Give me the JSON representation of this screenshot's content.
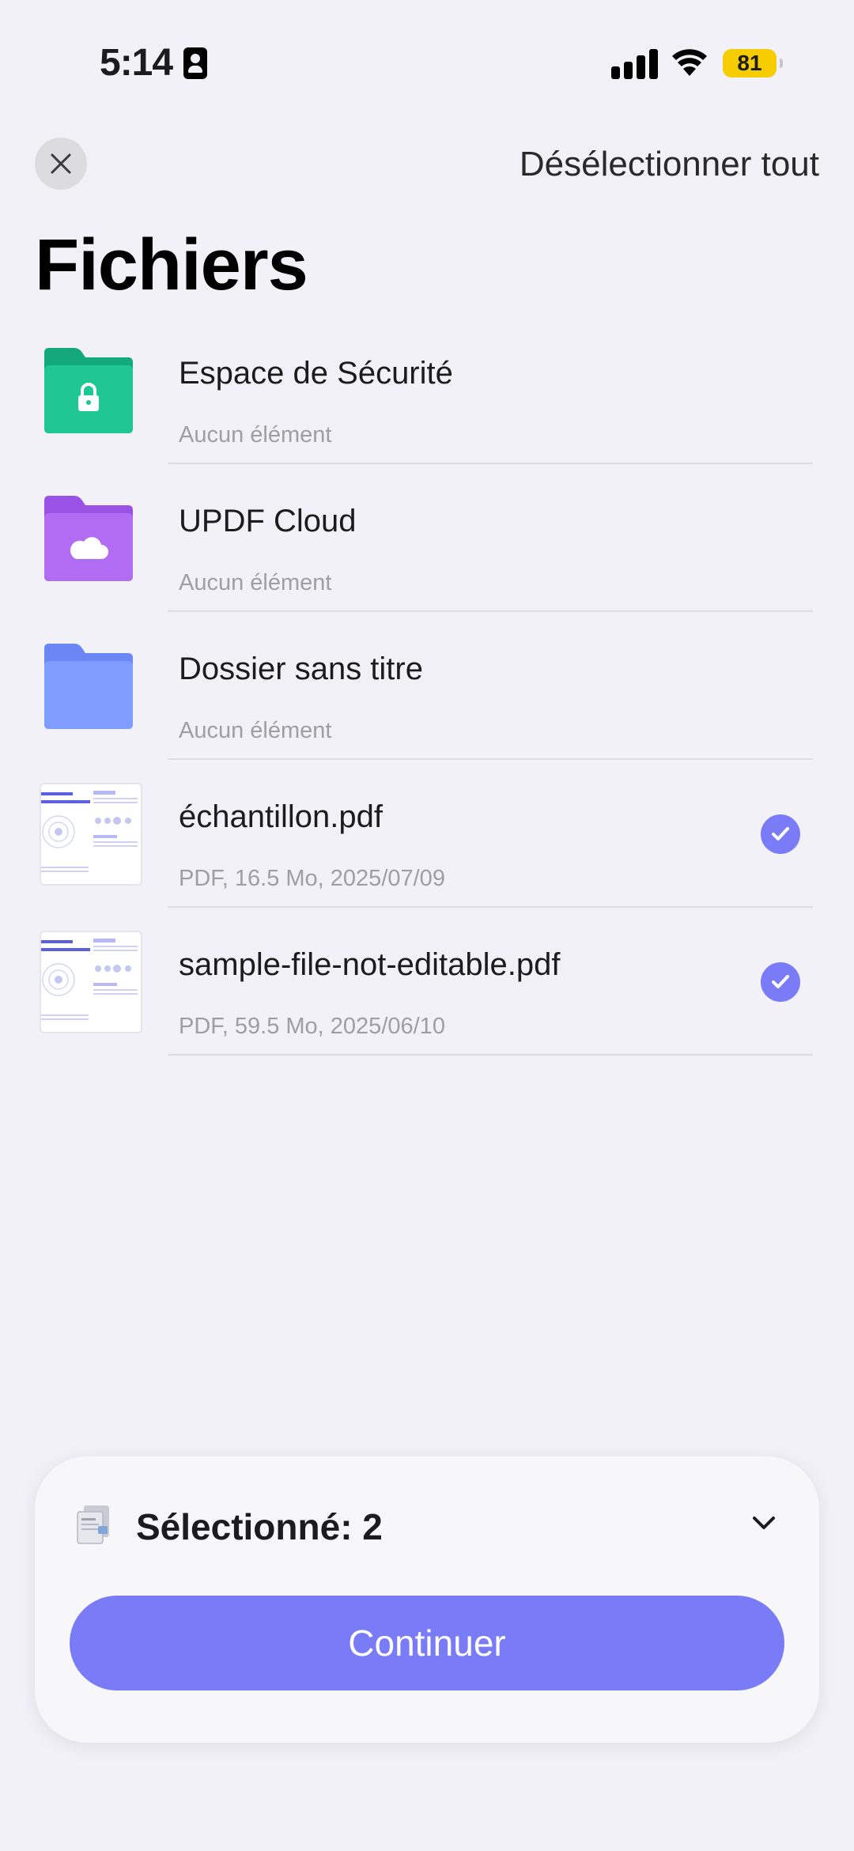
{
  "status_bar": {
    "time": "5:14",
    "battery": "81",
    "battery_color": "#f6cd00"
  },
  "header": {
    "close_icon": "close-icon",
    "deselect_label": "Désélectionner tout",
    "title": "Fichiers"
  },
  "items": [
    {
      "name": "Espace de Sécurité",
      "meta": "Aucun élément",
      "icon": "lock-folder-icon",
      "color": "#1fc794",
      "selected": false
    },
    {
      "name": "UPDF Cloud",
      "meta": "Aucun élément",
      "icon": "cloud-folder-icon",
      "color": "#b16cf3",
      "selected": false
    },
    {
      "name": "Dossier sans titre",
      "meta": "Aucun élément",
      "icon": "folder-icon",
      "color": "#7f9dff",
      "selected": false
    },
    {
      "name": "échantillon.pdf",
      "meta": "PDF, 16.5 Mo, 2025/07/09",
      "icon": "pdf-thumbnail",
      "selected": true
    },
    {
      "name": "sample-file-not-editable.pdf",
      "meta": "PDF, 59.5 Mo, 2025/06/10",
      "icon": "pdf-thumbnail",
      "selected": true
    }
  ],
  "bottom_panel": {
    "selected_label": "Sélectionné: 2",
    "continue_label": "Continuer",
    "accent_color": "#7a7cf7"
  }
}
